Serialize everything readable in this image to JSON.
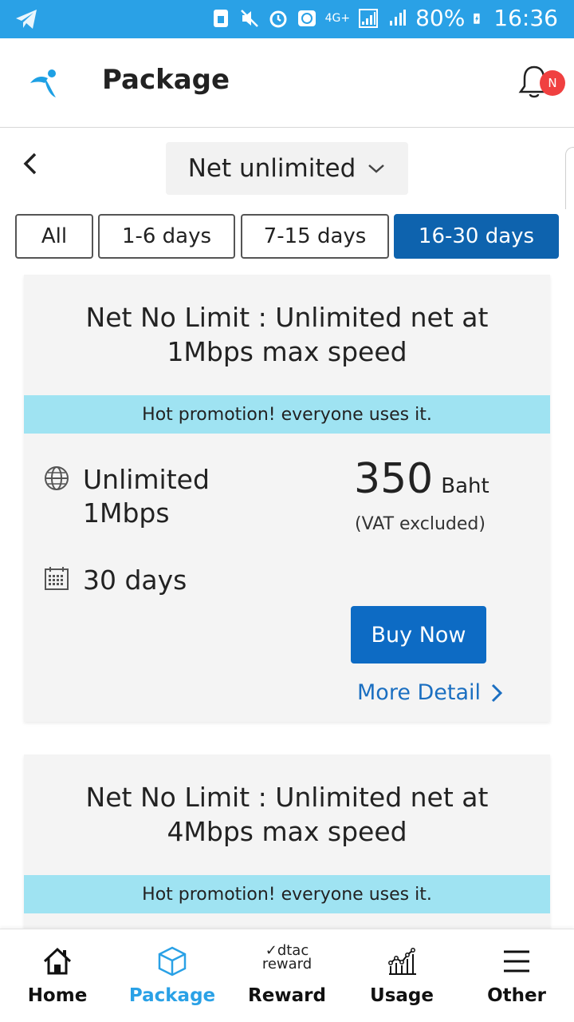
{
  "status_bar": {
    "battery": "80%",
    "time": "16:36",
    "network": "4G+"
  },
  "header": {
    "title": "Package",
    "notification_badge": "N"
  },
  "subheader": {
    "dropdown_value": "Net unlimited"
  },
  "filters": [
    {
      "label": "All",
      "active": false
    },
    {
      "label": "1-6 days",
      "active": false
    },
    {
      "label": "7-15 days",
      "active": false
    },
    {
      "label": "16-30 days",
      "active": true
    }
  ],
  "packages": [
    {
      "title": "Net No Limit : Unlimited net at 1Mbps max speed",
      "promo": "Hot promotion! everyone uses it.",
      "data_line1": "Unlimited",
      "data_line2": "1Mbps",
      "validity": "30 days",
      "price": "350",
      "currency": "Baht",
      "vat_note": "(VAT excluded)",
      "buy_label": "Buy Now",
      "more_label": "More Detail"
    },
    {
      "title": "Net No Limit : Unlimited net at 4Mbps max speed",
      "promo": "Hot promotion! everyone uses it."
    }
  ],
  "bottom_nav": [
    {
      "label": "Home",
      "icon": "home-icon",
      "active": false
    },
    {
      "label": "Package",
      "icon": "package-icon",
      "active": true
    },
    {
      "label": "Reward",
      "icon": "dtac-reward-logo",
      "logo_line1": "dtac",
      "logo_line2": "reward",
      "active": false
    },
    {
      "label": "Usage",
      "icon": "usage-chart-icon",
      "active": false
    },
    {
      "label": "Other",
      "icon": "menu-icon",
      "active": false
    }
  ],
  "colors": {
    "status_bar": "#2aa1e6",
    "primary_blue": "#0e63ae",
    "button_blue": "#0d6bc4",
    "promo_bg": "#9fe3f2",
    "active_nav": "#2aa1e6",
    "badge_red": "#f04040"
  }
}
